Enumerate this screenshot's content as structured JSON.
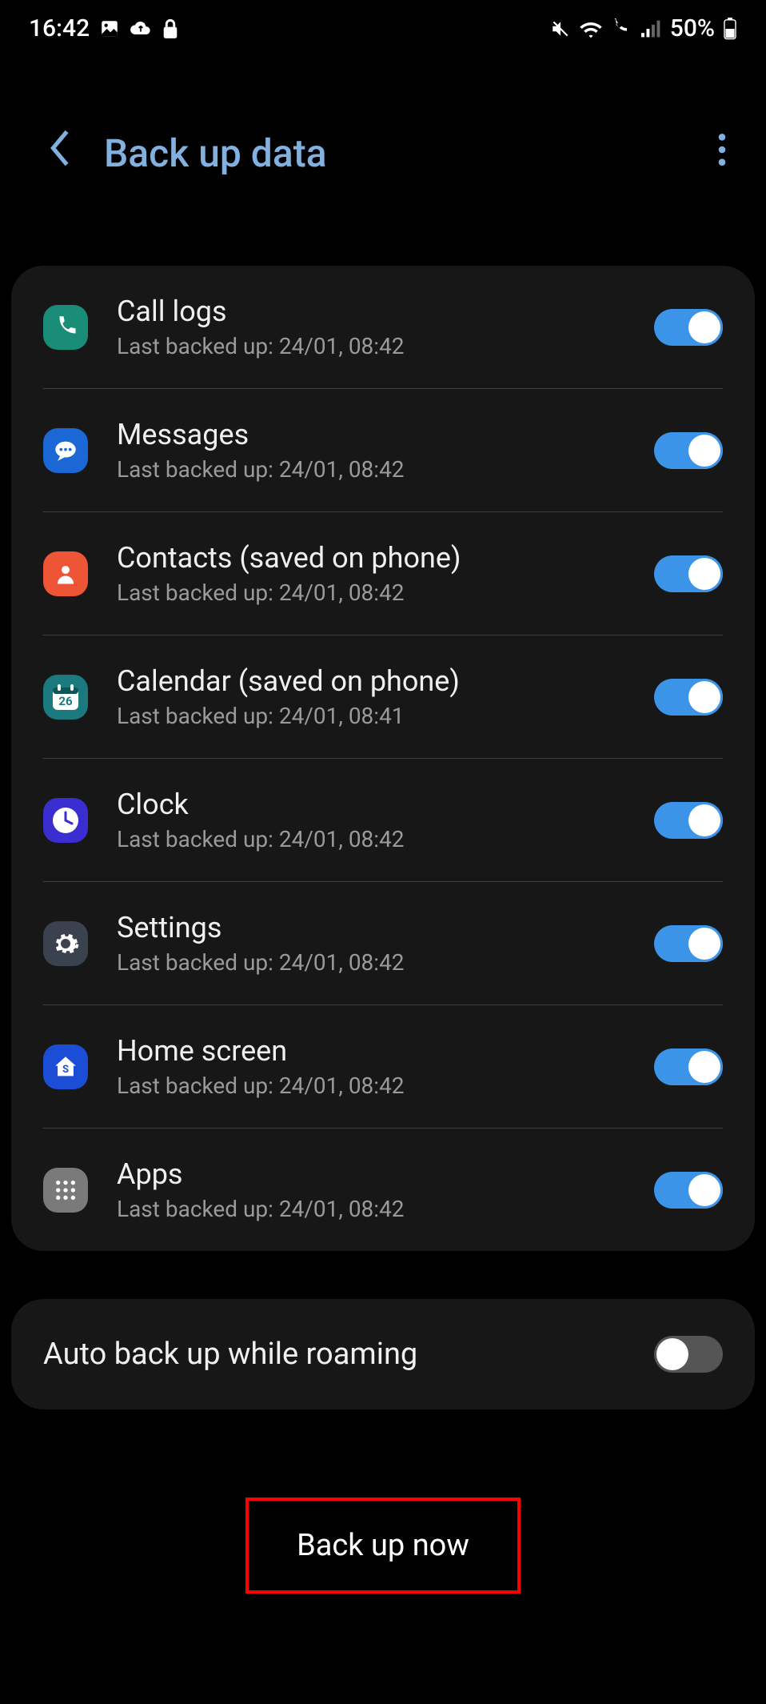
{
  "status": {
    "time": "16:42",
    "battery": "50%"
  },
  "header": {
    "title": "Back up data"
  },
  "items": [
    {
      "title": "Call logs",
      "sub": "Last backed up: 24/01, 08:42",
      "on": true,
      "iconClass": "icon-phone",
      "iconName": "phone-icon"
    },
    {
      "title": "Messages",
      "sub": "Last backed up: 24/01, 08:42",
      "on": true,
      "iconClass": "icon-msg",
      "iconName": "messages-icon"
    },
    {
      "title": "Contacts (saved on phone)",
      "sub": "Last backed up: 24/01, 08:42",
      "on": true,
      "iconClass": "icon-contacts",
      "iconName": "contacts-icon"
    },
    {
      "title": "Calendar (saved on phone)",
      "sub": "Last backed up: 24/01, 08:41",
      "on": true,
      "iconClass": "icon-cal",
      "iconName": "calendar-icon"
    },
    {
      "title": "Clock",
      "sub": "Last backed up: 24/01, 08:42",
      "on": true,
      "iconClass": "icon-clock",
      "iconName": "clock-icon"
    },
    {
      "title": "Settings",
      "sub": "Last backed up: 24/01, 08:42",
      "on": true,
      "iconClass": "icon-settings",
      "iconName": "settings-icon"
    },
    {
      "title": "Home screen",
      "sub": "Last backed up: 24/01, 08:42",
      "on": true,
      "iconClass": "icon-home",
      "iconName": "home-icon"
    },
    {
      "title": "Apps",
      "sub": "Last backed up: 24/01, 08:42",
      "on": true,
      "iconClass": "icon-apps",
      "iconName": "apps-icon"
    }
  ],
  "roaming": {
    "label": "Auto back up while roaming",
    "on": false
  },
  "action": {
    "label": "Back up now"
  },
  "calendarDay": "26"
}
